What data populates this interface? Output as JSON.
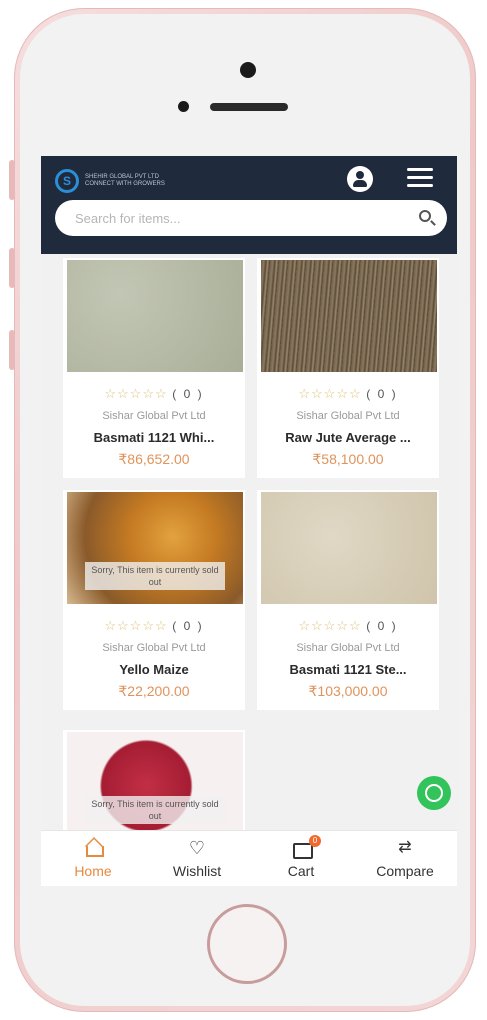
{
  "app": {
    "logo_text": "SHEHIR GLOBAL PVT LTD",
    "logo_tagline": "CONNECT WITH GROWERS"
  },
  "search": {
    "placeholder": "Search for items..."
  },
  "products": [
    {
      "rating_count": "( 0 )",
      "seller": "Sishar Global Pvt Ltd",
      "name": "Basmati 1121 Whi...",
      "price": "₹86,652.00",
      "stars": "☆☆☆☆☆",
      "sold_out": false
    },
    {
      "rating_count": "( 0 )",
      "seller": "Sishar Global Pvt Ltd",
      "name": "Raw Jute Average ...",
      "price": "₹58,100.00",
      "stars": "☆☆☆☆☆",
      "sold_out": false
    },
    {
      "rating_count": "( 0 )",
      "seller": "Sishar Global Pvt Ltd",
      "name": "Yello Maize",
      "price": "₹22,200.00",
      "stars": "☆☆☆☆☆",
      "sold_out": true,
      "sold_out_text": "Sorry, This item is currently sold out"
    },
    {
      "rating_count": "( 0 )",
      "seller": "Sishar Global Pvt Ltd",
      "name": "Basmati 1121 Ste...",
      "price": "₹103,000.00",
      "stars": "☆☆☆☆☆",
      "sold_out": false
    },
    {
      "sold_out": true,
      "sold_out_text": "Sorry, This item is currently sold out"
    }
  ],
  "bottom_nav": {
    "home": "Home",
    "wishlist": "Wishlist",
    "cart": "Cart",
    "cart_count": "0",
    "compare": "Compare"
  },
  "icons": {
    "heart": "♡",
    "compare": "⇄"
  },
  "colors": {
    "header_bg": "#1f2a3d",
    "accent": "#e68a3e",
    "price": "#e0935a",
    "whatsapp": "#32c45b"
  }
}
